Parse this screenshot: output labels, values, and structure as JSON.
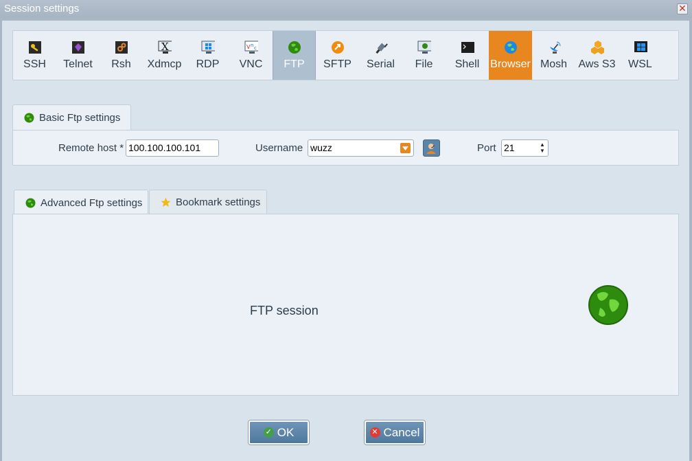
{
  "window": {
    "title": "Session settings",
    "close_glyph": "✕"
  },
  "protocols": [
    {
      "label": "SSH",
      "icon": "key-icon",
      "state": "normal"
    },
    {
      "label": "Telnet",
      "icon": "telnet-icon",
      "state": "normal"
    },
    {
      "label": "Rsh",
      "icon": "rsh-icon",
      "state": "normal"
    },
    {
      "label": "Xdmcp",
      "icon": "xdmcp-icon",
      "state": "normal"
    },
    {
      "label": "RDP",
      "icon": "rdp-monitor-icon",
      "state": "normal"
    },
    {
      "label": "VNC",
      "icon": "vnc-icon",
      "state": "normal"
    },
    {
      "label": "FTP",
      "icon": "globe-icon",
      "state": "selected"
    },
    {
      "label": "SFTP",
      "icon": "sftp-icon",
      "state": "normal"
    },
    {
      "label": "Serial",
      "icon": "serial-plug-icon",
      "state": "normal"
    },
    {
      "label": "File",
      "icon": "file-monitor-icon",
      "state": "normal"
    },
    {
      "label": "Shell",
      "icon": "terminal-icon",
      "state": "normal"
    },
    {
      "label": "Browser",
      "icon": "browser-globe-icon",
      "state": "hover"
    },
    {
      "label": "Mosh",
      "icon": "satellite-icon",
      "state": "normal"
    },
    {
      "label": "Aws S3",
      "icon": "aws-cubes-icon",
      "state": "normal"
    },
    {
      "label": "WSL",
      "icon": "windows-icon",
      "state": "normal"
    }
  ],
  "basic": {
    "tab_label": "Basic Ftp settings",
    "remote_host_label": "Remote host *",
    "remote_host_value": "100.100.100.101",
    "username_label": "Username",
    "username_value": "wuzz",
    "port_label": "Port",
    "port_value": "21"
  },
  "advanced": {
    "tab_label": "Advanced Ftp settings",
    "bookmark_tab_label": "Bookmark settings",
    "session_text": "FTP session"
  },
  "buttons": {
    "ok": "OK",
    "cancel": "Cancel"
  },
  "colors": {
    "accent_orange": "#e8861f",
    "selected_blue": "#aebfcf",
    "globe_green": "#2e8b0e"
  }
}
